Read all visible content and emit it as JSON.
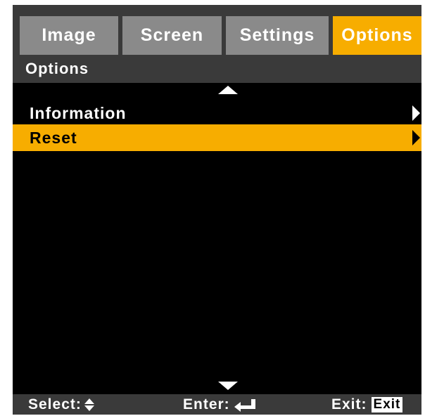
{
  "tabs": [
    {
      "label": "Image",
      "active": false
    },
    {
      "label": "Screen",
      "active": false
    },
    {
      "label": "Settings",
      "active": false
    },
    {
      "label": "Options",
      "active": true
    }
  ],
  "section_title": "Options",
  "menu": {
    "items": [
      {
        "label": "Information",
        "selected": false
      },
      {
        "label": "Reset",
        "selected": true
      }
    ]
  },
  "footer": {
    "select_label": "Select:",
    "enter_label": "Enter:",
    "exit_label": "Exit:",
    "exit_key": "Exit"
  },
  "colors": {
    "accent": "#f7ad00",
    "tab_inactive": "#8a8a8a",
    "frame": "#3a3a3a",
    "content_bg": "#000000"
  },
  "icons": [
    "scroll-up-arrow-icon",
    "scroll-down-arrow-icon",
    "submenu-arrow-icon",
    "updown-arrows-icon",
    "enter-key-icon"
  ]
}
